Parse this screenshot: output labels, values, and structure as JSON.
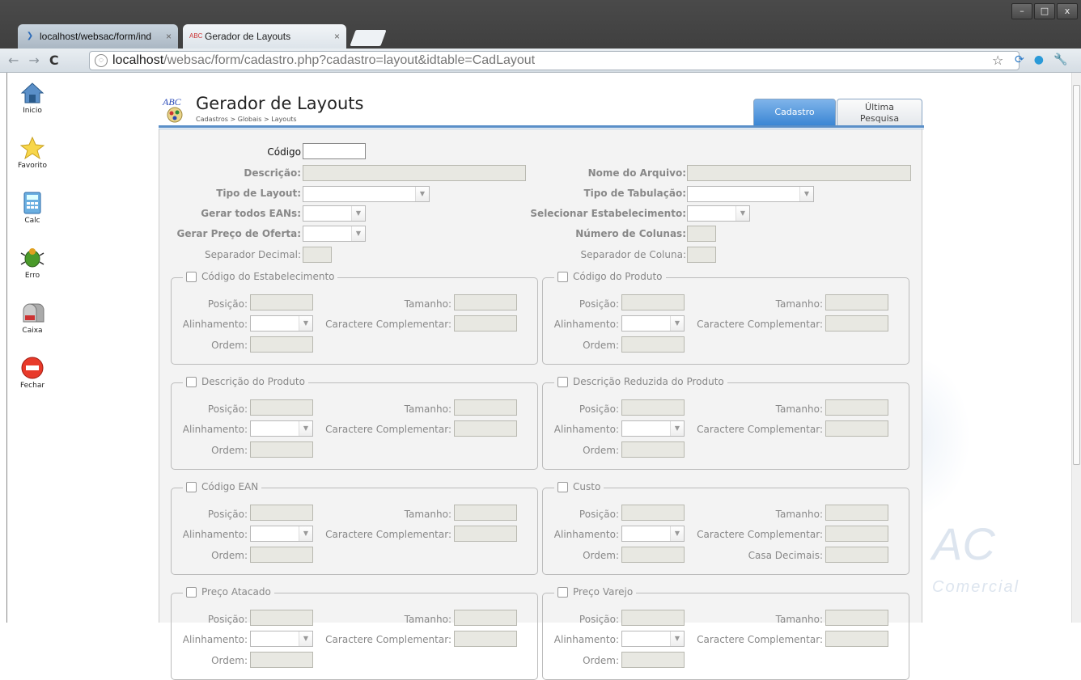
{
  "browser": {
    "tabs": [
      {
        "label": "localhost/websac/form/ind",
        "close": "×"
      },
      {
        "label": "Gerador de Layouts",
        "close": "×"
      }
    ],
    "url_host": "localhost",
    "url_path": "/websac/form/cadastro.php?cadastro=layout&idtable=CadLayout",
    "window_controls": [
      "–",
      "□",
      "x"
    ]
  },
  "sidebar": {
    "items": [
      {
        "label": "Inicio",
        "icon": "home-icon"
      },
      {
        "label": "Favorito",
        "icon": "star-icon"
      },
      {
        "label": "Calc",
        "icon": "calculator-icon"
      },
      {
        "label": "Erro",
        "icon": "bug-icon"
      },
      {
        "label": "Caixa",
        "icon": "mailbox-icon"
      },
      {
        "label": "Fechar",
        "icon": "no-entry-icon"
      }
    ]
  },
  "header": {
    "logo_text": "ABC",
    "title": "Gerador de Layouts",
    "breadcrumb": "Cadastros > Globais > Layouts",
    "tabs": {
      "cadastro": "Cadastro",
      "ultima_1": "Última",
      "ultima_2": "Pesquisa"
    }
  },
  "form": {
    "codigo": "Código",
    "descricao": "Descrição:",
    "tipo_layout": "Tipo de Layout:",
    "gerar_eans": "Gerar todos EANs:",
    "gerar_preco": "Gerar Preço de Oferta:",
    "sep_decimal": "Separador Decimal:",
    "nome_arquivo": "Nome do Arquivo:",
    "tipo_tabulacao": "Tipo de Tabulação:",
    "sel_estab": "Selecionar Estabelecimento:",
    "num_colunas": "Número de Colunas:",
    "sep_coluna": "Separador de Coluna:"
  },
  "field_labels": {
    "posicao": "Posição:",
    "tamanho": "Tamanho:",
    "alinhamento": "Alinhamento:",
    "caractere": "Caractere Complementar:",
    "ordem": "Ordem:",
    "casa_decimais": "Casa Decimais:"
  },
  "groups": [
    "Código do Estabelecimento",
    "Código do Produto",
    "Descrição do Produto",
    "Descrição Reduzida do Produto",
    "Código EAN",
    "Custo",
    "Preço Atacado",
    "Preço Varejo"
  ],
  "watermark": {
    "big": "AC",
    "small": "Comercial"
  }
}
